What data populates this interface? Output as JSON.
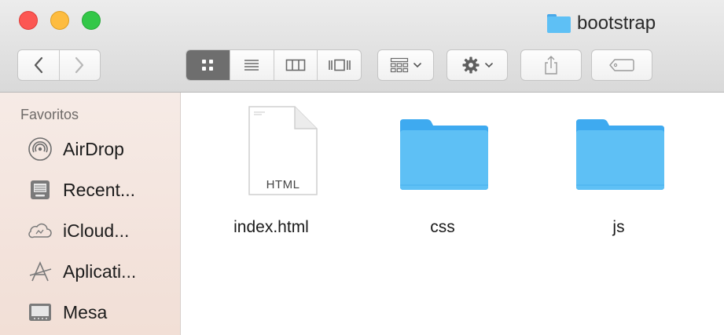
{
  "window": {
    "title": "bootstrap"
  },
  "toolbar": {
    "back_icon": "chevron-left-icon",
    "forward_icon": "chevron-right-icon",
    "view_modes": [
      "icon-view",
      "list-view",
      "column-view",
      "cover-flow-view"
    ],
    "active_view": "icon-view",
    "arrange_icon": "grid-arrange-icon",
    "action_icon": "gear-icon",
    "share_icon": "share-icon",
    "tags_icon": "tag-icon"
  },
  "sidebar": {
    "heading": "Favoritos",
    "items": [
      {
        "label": "AirDrop",
        "icon": "airdrop-icon"
      },
      {
        "label": "Recent...",
        "icon": "recents-icon"
      },
      {
        "label": "iCloud...",
        "icon": "icloud-icon"
      },
      {
        "label": "Aplicati...",
        "icon": "applications-icon"
      },
      {
        "label": "Mesa",
        "icon": "desktop-icon"
      }
    ]
  },
  "files": [
    {
      "name": "index.html",
      "kind": "document",
      "badge": "HTML"
    },
    {
      "name": "css",
      "kind": "folder"
    },
    {
      "name": "js",
      "kind": "folder"
    }
  ],
  "colors": {
    "folder": "#5ec0f5",
    "folder_dark": "#3eaaf0",
    "sidebar_bg": "#f4e6e0",
    "active_segment": "#6e6e6e",
    "close": "#fc5753",
    "minimize": "#fdbc40",
    "zoom": "#33c748"
  }
}
